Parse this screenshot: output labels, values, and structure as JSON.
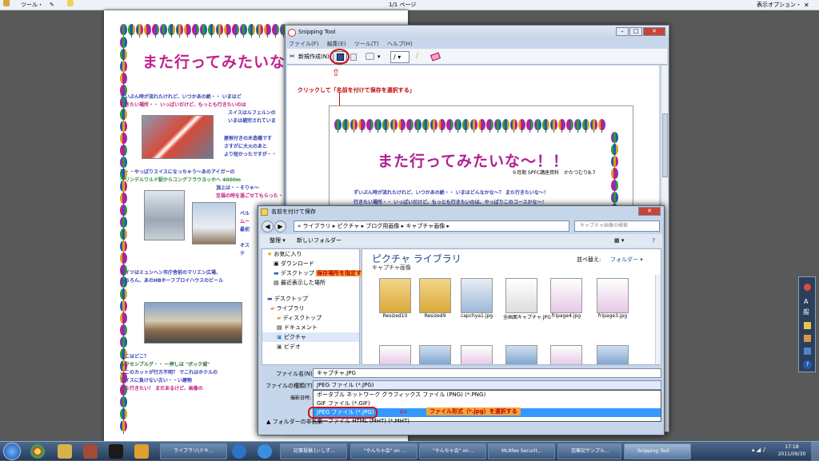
{
  "topbar": {
    "tools_label": "ツール・",
    "page_indicator": "1/1 ページ",
    "display_options": "表示オプション・"
  },
  "document": {
    "title": "また行ってみたいな～！！",
    "lines": [
      "ずいぶん時が流れたけれど、いつかあの絶・・ いまはど",
      "行きたい場所・・ いっぱいだけど、もっとも行きたいのは",
      "スイスはルフェルンの",
      "いまは補完されていま",
      "屋根付きの木造橋です",
      "さすがに大火のあと",
      "より短かったですが・・",
      "次・・やっぱりスイスになっちゃう～あのアイガーの",
      "グリンデルワルド駅からユングフラウヨッホへ 4000m",
      "頂上は・・そりゃ～",
      "至福の時を過ごせてもらった・・",
      "ベル",
      "ムー",
      "最初",
      "オス",
      "テ",
      "ドイツはミュンヘン市庁舎前のマリエン広場、",
      "もちろん、あのHBホーフブロイハウスのビール",
      "ここはどこ？",
      "ルクセンブルグ・・ 一押しは \"ボック城\"",
      "ここのカットが行方不明？ でこれはホテルの",
      "スイスに負けない古い・・い建物",
      "また行きたい！ まだあるけど、画像の"
    ]
  },
  "snipping": {
    "title": "Snipping Tool",
    "menu": [
      "ファイル(F)",
      "編集(E)",
      "ツール(T)",
      "ヘルプ(H)"
    ],
    "new_button": "新規作成(N)",
    "instruction": "クリックして「名前を付けて保存を選択する」",
    "inner_title": "また行ってみたいな～！！",
    "inner_subtitle": "９月期 SPFC講座資料　かたつむり8.7",
    "inner_line1": "ずいぶん時が流れたけれど、いつかあの絶・・ いまはどんなかな～？ また行きたいな～！",
    "inner_line1b": "また行きたいな～！",
    "inner_line2": "行きたい場所・・ いっぱいだけど、もっとも行きたいのは、やっぱりこのコースかな～！"
  },
  "save_dialog": {
    "title": "名前を付けて保存",
    "breadcrumb": [
      "ライブラリ",
      "ピクチャ",
      "ブログ用画像",
      "キャプチャ画像"
    ],
    "search_placeholder": "キャプチャ画像の検索",
    "organize": "整理 ▾",
    "new_folder": "新しいフォルダー",
    "nav_items": [
      "お気に入り",
      "ダウンロード",
      "デスクトップ",
      "最近表示した場所",
      "デスクトップ",
      "ライブラリ",
      "ディスクトップ",
      "ドキュメント",
      "ピクチャ",
      "ビデオ"
    ],
    "save_location_note": "保存場所を指定する",
    "library_title": "ピクチャ ライブラリ",
    "library_sub": "キャプチャ画像",
    "arrange_label": "並べ替え:",
    "arrange_value": "フォルダー ▾",
    "files": [
      "Resized10",
      "Resized9",
      "capchya1.jpg",
      "全画面キャプチャ.JPG",
      "fripage4.jpg",
      "fripage3.jpg"
    ],
    "filename_label": "ファイル名(N):",
    "filename_value": "キャプチャ.JPG",
    "filetype_label": "ファイルの種類(T):",
    "filetype_value": "JPEG ファイル (*.JPG)",
    "author_label": "撮影日時:",
    "filetype_options": [
      "ポータブル ネットワーク グラフィックス ファイル (PNG) (*.PNG)",
      "GIF ファイル (*.GIF)",
      "JPEG ファイル (*.JPG)",
      "単一ファイル HTML (MHT) (*.MHT)"
    ],
    "filetype_note": "ファイル形式（*.jpg）を選択する",
    "hide_folders": "フォルダーの非表示"
  },
  "taskbar": {
    "buttons": [
      "ライブラリ\\ドキ...",
      "記事投稿 [ぃしず...",
      "\"やんちゃ会\" on ...",
      "\"やんちゃ会\" on ...",
      "McAfee Securit...",
      "芭蕉記サンプル...",
      "Snipping Tool"
    ],
    "time": "17:18",
    "date": "2011/09/30"
  },
  "ime": {
    "mode": "般"
  },
  "colors": {
    "snip_frame": "#c7d6ea",
    "highlight": "#3399ff",
    "annot_red": "#c00000",
    "note_orange": "#f7a43a"
  }
}
